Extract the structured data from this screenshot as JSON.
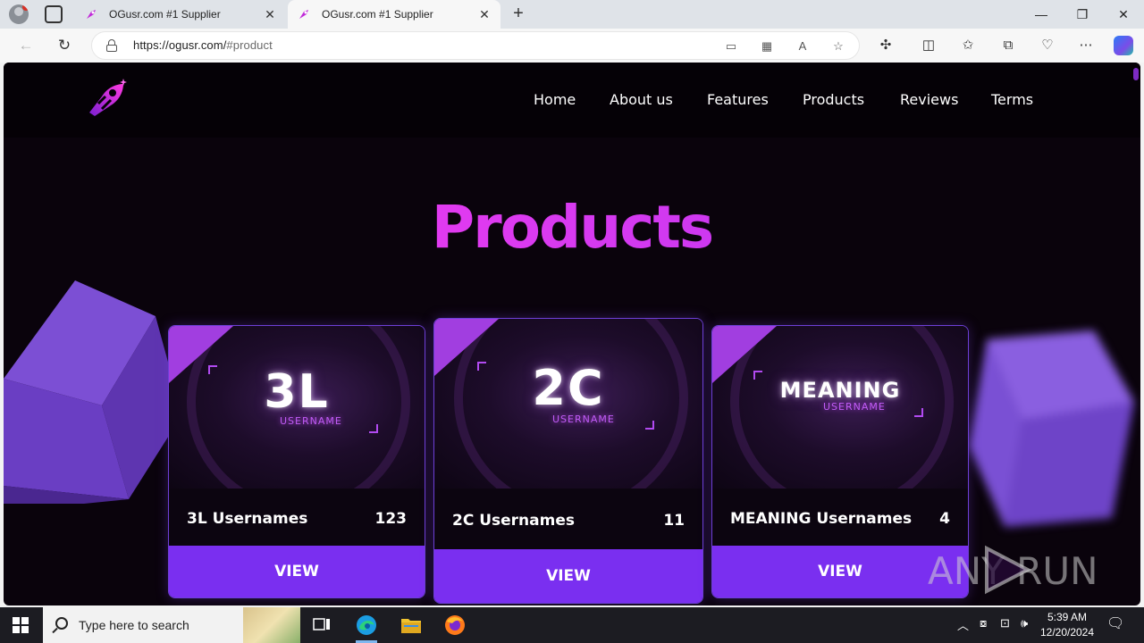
{
  "browser": {
    "tabs": [
      {
        "title": "OGusr.com #1 Supplier",
        "active": false
      },
      {
        "title": "OGusr.com #1 Supplier",
        "active": true
      }
    ],
    "url_host": "https://ogusr.com/",
    "url_path": "#product",
    "window_controls": {
      "minimize": "—",
      "restore": "❐",
      "close": "✕"
    }
  },
  "site": {
    "nav": [
      "Home",
      "About us",
      "Features",
      "Products",
      "Reviews",
      "Terms"
    ],
    "section_title": "Products",
    "products": [
      {
        "banner_title": "3L",
        "banner_sub": "USERNAME",
        "name": "3L Usernames",
        "count": "123",
        "button": "VIEW"
      },
      {
        "banner_title": "2C",
        "banner_sub": "USERNAME",
        "name": "2C Usernames",
        "count": "11",
        "button": "VIEW"
      },
      {
        "banner_title": "MEANING",
        "banner_sub": "USERNAME",
        "name": "MEANING Usernames",
        "count": "4",
        "button": "VIEW"
      }
    ],
    "accent_color": "#7a2ff0",
    "title_gradient": [
      "#ff3ef0",
      "#b035f0"
    ]
  },
  "watermark": {
    "text": "ANY RUN"
  },
  "taskbar": {
    "search_placeholder": "Type here to search",
    "time": "5:39 AM",
    "date": "12/20/2024"
  }
}
